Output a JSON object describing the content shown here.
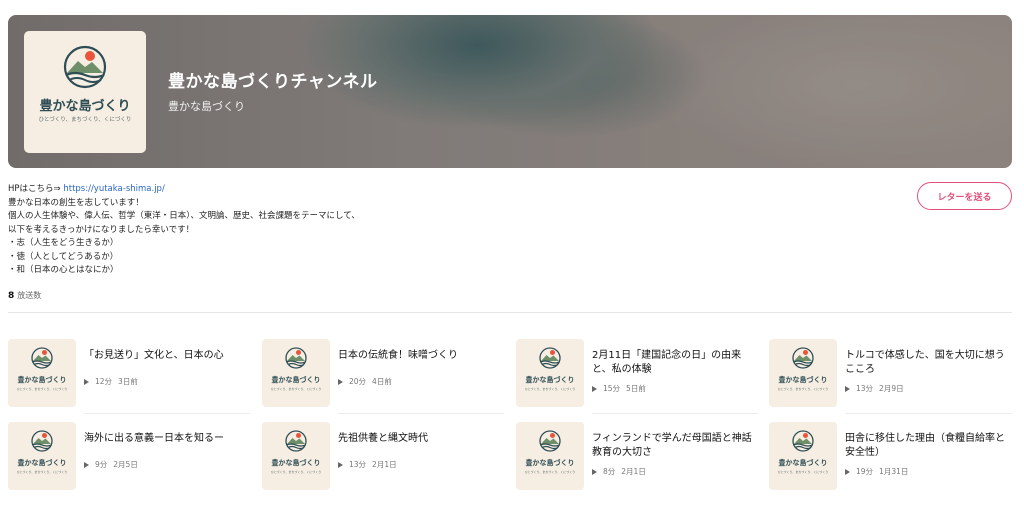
{
  "channel": {
    "title": "豊かな島づくりチャンネル",
    "subtitle": "豊かな島づくり",
    "logo_text": "豊かな島づくり",
    "logo_tagline": "ひとづくり、まちづくり、くにづくり"
  },
  "description": {
    "hp_prefix": "HPはこちら⇒ ",
    "hp_link": "https://yutaka-shima.jp/",
    "lines": [
      "豊かな日本の創生を志しています！",
      "個人の人生体験や、偉人伝、哲学（東洋・日本）、文明論、歴史、社会課題をテーマにして、",
      "以下を考えるきっかけになりましたら幸いです！",
      "・志（人生をどう生きるか）",
      "・徳（人としてどうあるか）",
      "・和（日本の心とはなにか）"
    ]
  },
  "stats": {
    "count": "8",
    "count_label": "放送数"
  },
  "letter_button": "レターを送る",
  "episodes": [
    {
      "title": "「お見送り」文化と、日本の心",
      "duration": "12分",
      "date": "3日前"
    },
    {
      "title": "日本の伝統食！味噌づくり",
      "duration": "20分",
      "date": "4日前"
    },
    {
      "title": "2月11日「建国記念の日」の由来と、私の体験",
      "duration": "15分",
      "date": "5日前"
    },
    {
      "title": "トルコで体感した、国を大切に想うこころ",
      "duration": "13分",
      "date": "2月9日"
    },
    {
      "title": "海外に出る意義ー日本を知るー",
      "duration": "9分",
      "date": "2月5日"
    },
    {
      "title": "先祖供養と縄文時代",
      "duration": "13分",
      "date": "2月1日"
    },
    {
      "title": "フィンランドで学んだ母国語と神話教育の大切さ",
      "duration": "8分",
      "date": "2月1日"
    },
    {
      "title": "田舎に移住した理由（食糧自給率と安全性）",
      "duration": "19分",
      "date": "1月31日"
    }
  ],
  "colors": {
    "accent": "#e0517a",
    "link": "#2b66c9",
    "logo_navy": "#2e4d55",
    "logo_sun": "#e8553b",
    "cover_bg": "#f6eee2"
  }
}
